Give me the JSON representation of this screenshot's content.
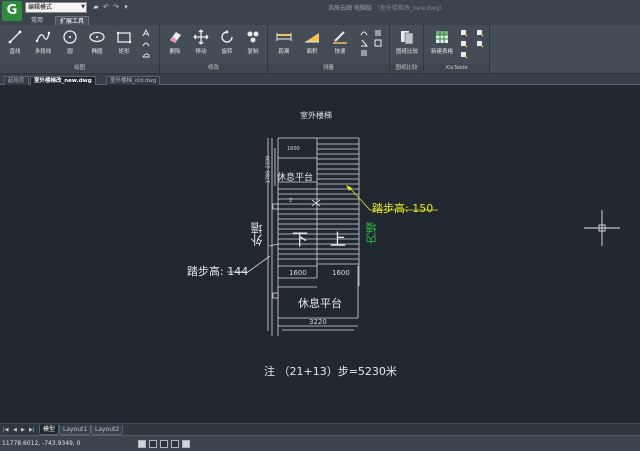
{
  "titlebar": {
    "logo_letter": "G",
    "mode_value": "编辑模式",
    "window_title": "浩辰云图 电脑版",
    "document_suffix": "（室外楼梯改_new.dwg）"
  },
  "ribbon_tabs": [
    "常用",
    "扩展工具"
  ],
  "ribbon": {
    "groups": [
      {
        "label": "绘图",
        "tools": [
          "直线",
          "多段线",
          "圆",
          "椭圆",
          "矩形"
        ]
      },
      {
        "label": "修改",
        "tools": [
          "删除",
          "移动",
          "旋转",
          "复制"
        ]
      },
      {
        "label": "测量",
        "tools": [
          "距离",
          "面积",
          "快速"
        ]
      },
      {
        "label": "图纸比较",
        "tools": [
          "图纸比较"
        ]
      },
      {
        "label": "XlsTable",
        "tools": [
          "新建表格"
        ]
      }
    ]
  },
  "doc_tabs": [
    "起始页",
    "室外楼梯改_new.dwg",
    "室外楼梯_old.dwg"
  ],
  "drawing": {
    "title": "室外楼梯",
    "dims": [
      "1600",
      "1600",
      "1600",
      "3220"
    ],
    "dim_small_labels": [
      "2100",
      "1780",
      "2"
    ],
    "landing_top": "休息平台",
    "landing_bottom": "休息平台",
    "outer_wall": "外墙",
    "inner_wall": "内墙",
    "down": "下",
    "up": "上",
    "step_height_right": "踏步高: 150",
    "step_height_left": "踏步高: 144",
    "note": "注 （21+13）步=5230米",
    "colors": {
      "line": "#d7dbdf",
      "highlight": "#e6e61e",
      "inner_wall": "#29c13a"
    }
  },
  "layout_tabs": [
    "模型",
    "Layout1",
    "Layout2"
  ],
  "status": {
    "coords": "11778.6012, -743.9349, 0"
  }
}
